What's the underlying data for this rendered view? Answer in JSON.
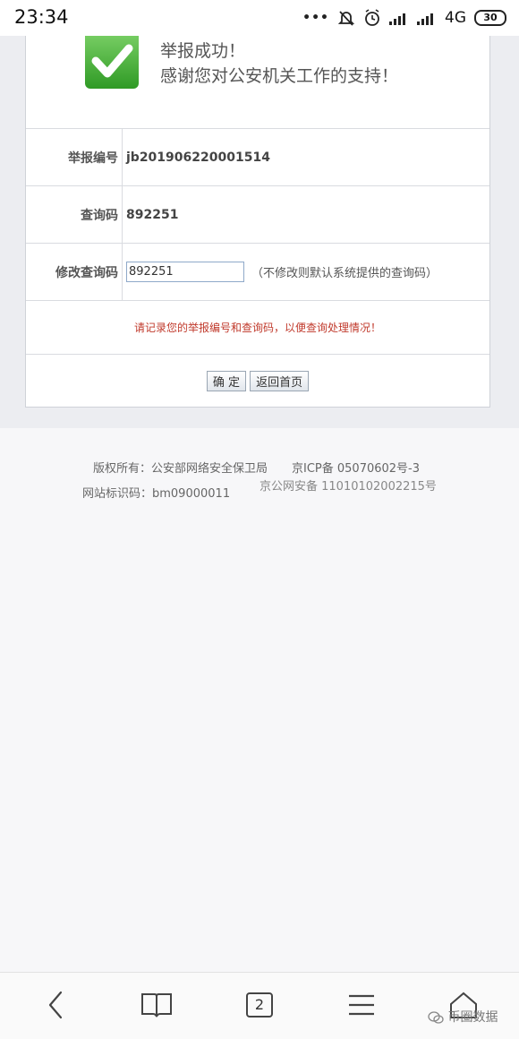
{
  "status_bar": {
    "time": "23:34",
    "network": "4G",
    "battery": "30"
  },
  "report": {
    "success_title": "举报成功！",
    "success_message": "感谢您对公安机关工作的支持！",
    "report_no_label": "举报编号",
    "report_no_value": "jb201906220001514",
    "query_code_label": "查询码",
    "query_code_value": "892251",
    "modify_label": "修改查询码",
    "modify_input_value": "892251",
    "modify_hint": "（不修改则默认系统提供的查询码）",
    "notice": "请记录您的举报编号和查询码，以便查询处理情况！",
    "confirm_button": "确 定",
    "back_button": "返回首页"
  },
  "footer": {
    "copyright": "版权所有：公安部网络安全保卫局",
    "icp": "京ICP备 05070602号-3",
    "site_id": "网站标识码：bm09000011",
    "security_record": "京公网安备 11010102002215号"
  },
  "bottom_nav": {
    "tab_count": "2",
    "icons": [
      "back-icon",
      "bookmarks-icon",
      "tabs-icon",
      "menu-icon",
      "home-icon"
    ]
  },
  "watermark": "币圈数据",
  "colors": {
    "notice": "#c0392b",
    "check_green": "#3aa52f"
  }
}
